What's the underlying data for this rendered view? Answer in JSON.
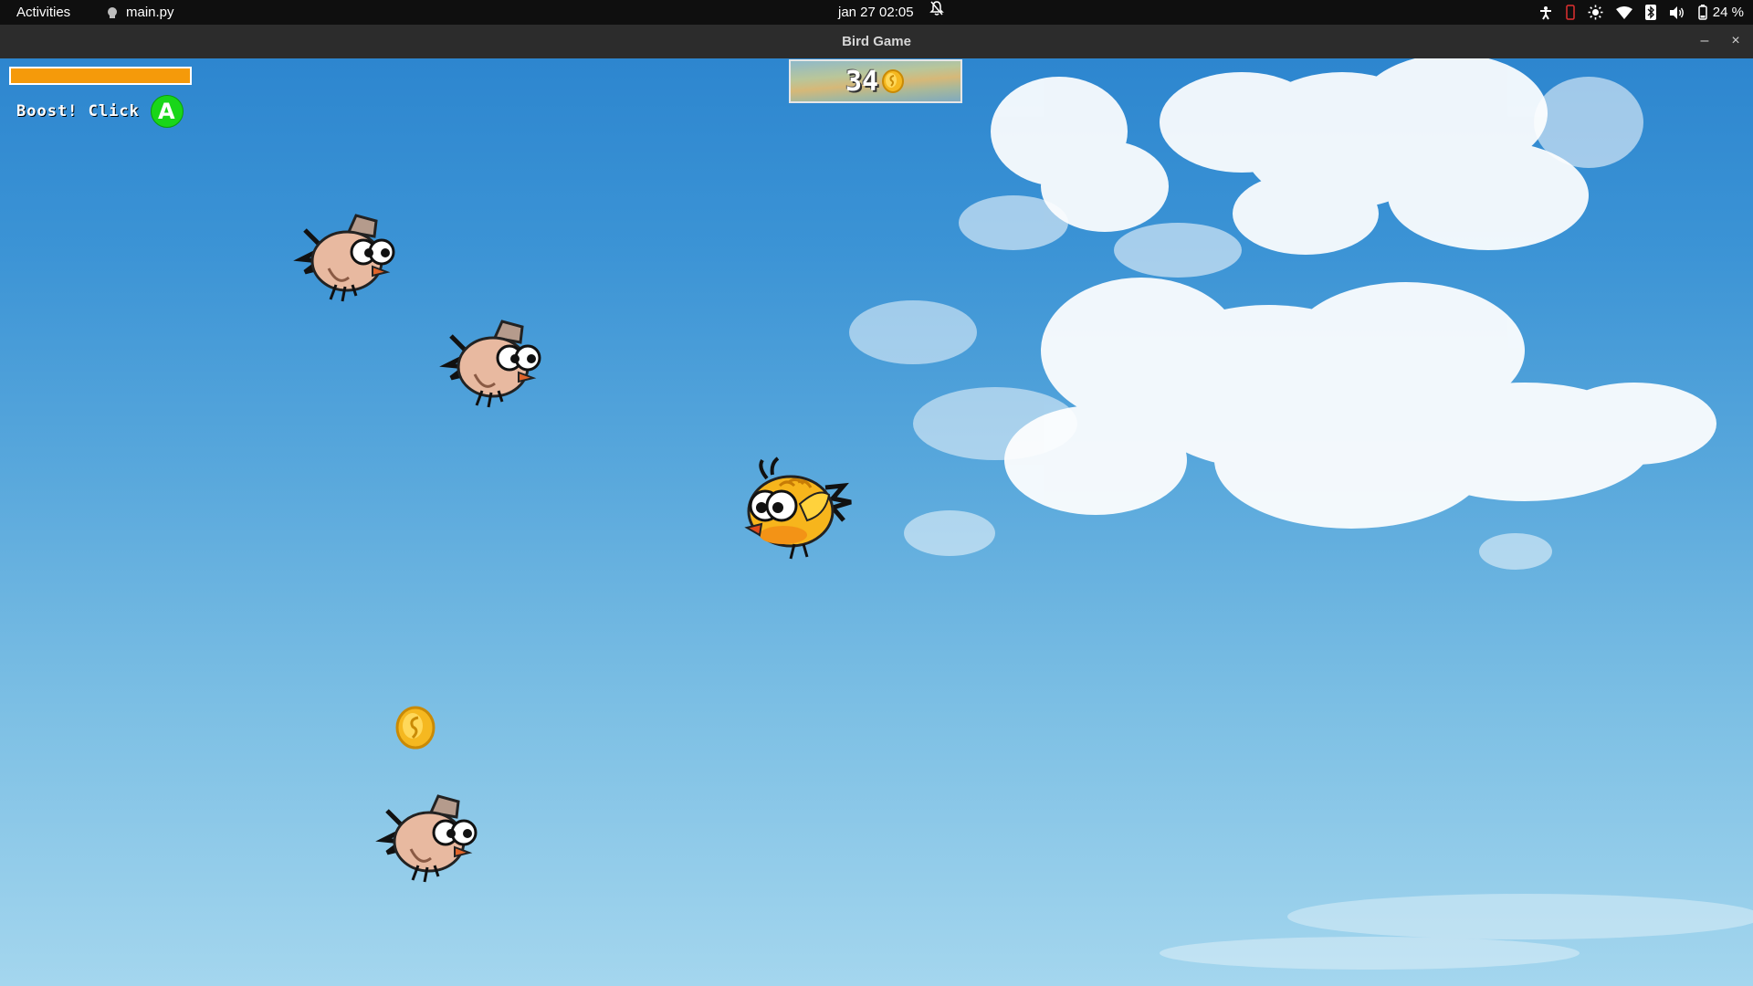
{
  "topbar": {
    "activities_label": "Activities",
    "app_name": "main.py",
    "clock": "jan 27  02:05",
    "battery_percent": "24 %",
    "tray_icons": [
      "accessibility-icon",
      "phone-icon",
      "brightness-icon",
      "wifi-icon",
      "bluetooth-icon",
      "volume-icon",
      "battery-icon"
    ]
  },
  "window": {
    "title": "Bird Game",
    "minimize_label": "–",
    "close_label": "×"
  },
  "hud": {
    "boost_label": "Boost! Click",
    "boost_button_letter": "A",
    "boost_level": 1.0,
    "score": "34",
    "boost_color": "#f59a0a",
    "button_color": "#19d619"
  },
  "sprites": {
    "player": "yellow-bird",
    "enemies": [
      "brown-bird",
      "brown-bird",
      "brown-bird"
    ],
    "pickups": [
      "gold-coin"
    ]
  }
}
